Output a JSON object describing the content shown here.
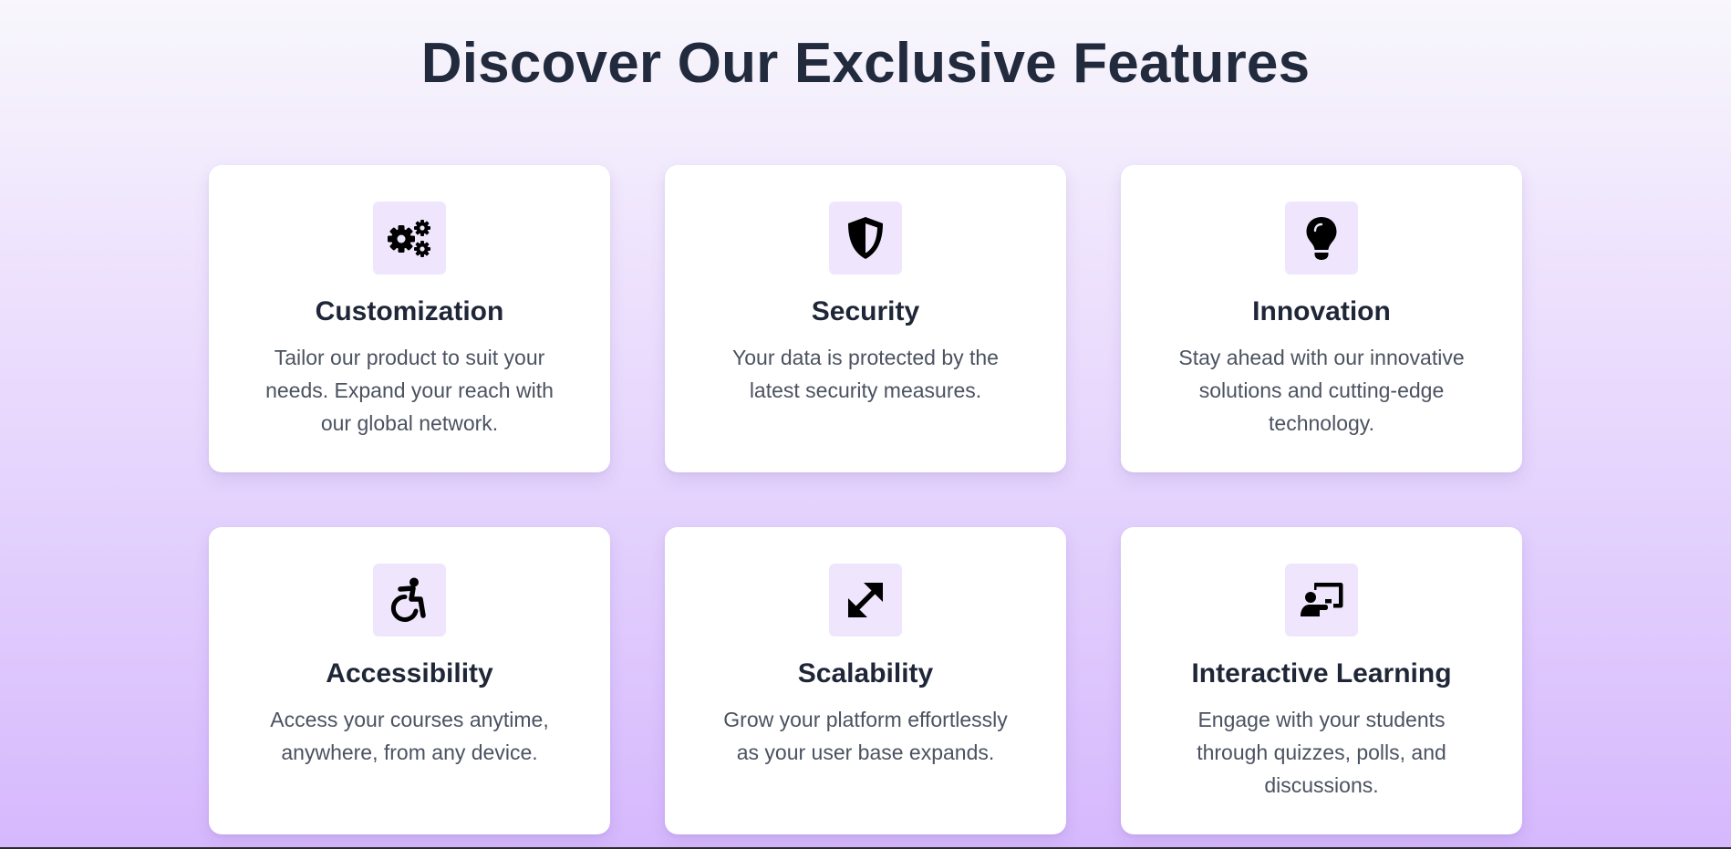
{
  "header": {
    "title": "Discover Our Exclusive Features"
  },
  "features": [
    {
      "icon": "gears-icon",
      "title": "Customization",
      "description": "Tailor our product to suit your needs. Expand your reach with our global network."
    },
    {
      "icon": "shield-icon",
      "title": "Security",
      "description": "Your data is protected by the latest security measures."
    },
    {
      "icon": "lightbulb-icon",
      "title": "Innovation",
      "description": "Stay ahead with our innovative solutions and cutting-edge technology."
    },
    {
      "icon": "accessibility-icon",
      "title": "Accessibility",
      "description": "Access your courses anytime, anywhere, from any device."
    },
    {
      "icon": "expand-arrows-icon",
      "title": "Scalability",
      "description": "Grow your platform effortlessly as your user base expands."
    },
    {
      "icon": "chalkboard-teacher-icon",
      "title": "Interactive Learning",
      "description": "Engage with your students through quizzes, polls, and discussions."
    }
  ],
  "colors": {
    "title_text": "#222b3d",
    "icon_background": "#efe6fd",
    "card_background": "#ffffff",
    "description_text": "#4b5260",
    "gradient_top": "#f8f7fc",
    "gradient_bottom": "#d6b8fd"
  }
}
